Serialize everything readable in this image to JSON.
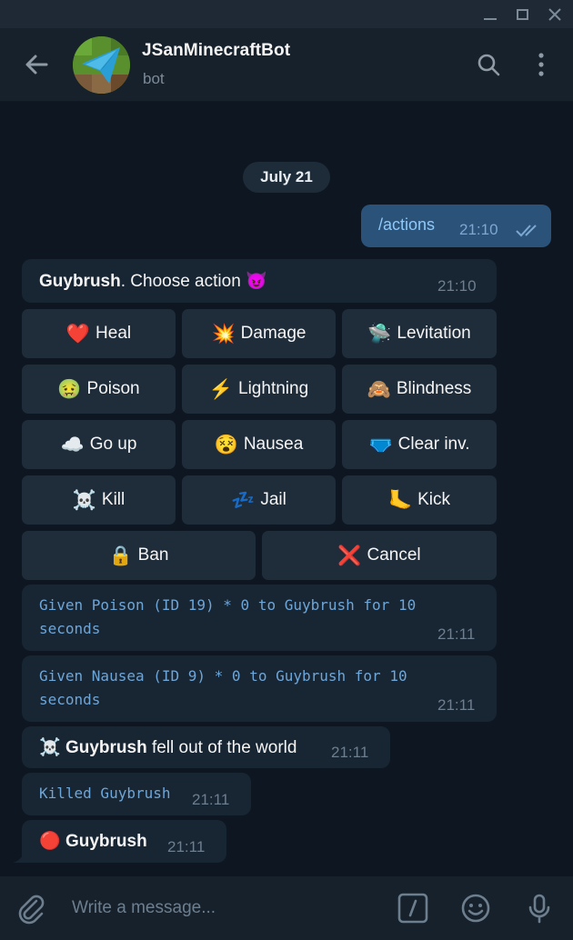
{
  "window": {
    "minimize": "minimize",
    "maximize": "maximize",
    "close": "close"
  },
  "header": {
    "title": "JSanMinecraftBot",
    "subtitle": "bot"
  },
  "date_separator": "July 21",
  "outgoing": {
    "text": "/actions",
    "time": "21:10",
    "status": "read"
  },
  "prompt": {
    "name": "Guybrush",
    "text": ". Choose action",
    "emoji": "😈",
    "time": "21:10"
  },
  "keyboard": [
    [
      {
        "emoji": "❤️",
        "label": "Heal"
      },
      {
        "emoji": "💥",
        "label": "Damage"
      },
      {
        "emoji": "🛸",
        "label": "Levitation"
      }
    ],
    [
      {
        "emoji": "🤢",
        "label": "Poison"
      },
      {
        "emoji": "⚡",
        "label": "Lightning"
      },
      {
        "emoji": "🙈",
        "label": "Blindness"
      }
    ],
    [
      {
        "emoji": "☁️",
        "label": "Go up"
      },
      {
        "emoji": "😵",
        "label": "Nausea"
      },
      {
        "emoji": "🩲",
        "label": "Clear inv."
      }
    ],
    [
      {
        "emoji": "☠️",
        "label": "Kill"
      },
      {
        "emoji": "💤",
        "label": "Jail"
      },
      {
        "emoji": "🦶",
        "label": "Kick"
      }
    ],
    [
      {
        "emoji": "🔒",
        "label": "Ban"
      },
      {
        "emoji": "❌",
        "label": "Cancel"
      }
    ]
  ],
  "messages": [
    {
      "line1": "Given Poison (ID 19) * 0 to Guybrush for 10",
      "line2": "seconds",
      "time": "21:11"
    },
    {
      "line1": "Given Nausea (ID 9) * 0 to Guybrush for 10",
      "line2": "seconds",
      "time": "21:11"
    },
    {
      "emoji": "☠️",
      "name": "Guybrush",
      "text": " fell out of the world",
      "time": "21:11"
    },
    {
      "text": "Killed Guybrush",
      "time": "21:11"
    },
    {
      "emoji": "🔴",
      "name": "Guybrush",
      "time": "21:11"
    }
  ],
  "composer": {
    "placeholder": "Write a message..."
  },
  "icons": {
    "back": "arrow-left-icon",
    "search": "search-icon",
    "more": "more-vert-icon",
    "attach": "paperclip-icon",
    "commands": "slash-command-icon",
    "emoji": "smiley-icon",
    "mic": "microphone-icon"
  },
  "colors": {
    "background": "#0e1621",
    "header": "#17212b",
    "incoming": "#182533",
    "outgoing": "#2b5278",
    "keyboard_button": "#1f2c3a",
    "mono_text": "#6ea6d8"
  }
}
